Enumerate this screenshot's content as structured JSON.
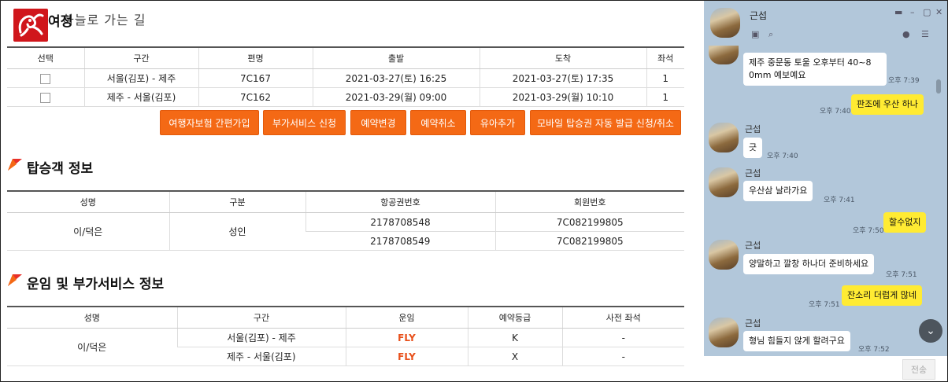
{
  "header": {
    "logo_text": "하늘로 가는 길",
    "itinerary_title": "여정"
  },
  "itinerary": {
    "headers": [
      "선택",
      "구간",
      "편명",
      "출발",
      "도착",
      "좌석"
    ],
    "rows": [
      {
        "route": "서울(김포) - 제주",
        "flight": "7C167",
        "depart": "2021-03-27(토) 16:25",
        "arrive": "2021-03-27(토) 17:35",
        "seats": "1"
      },
      {
        "route": "제주 - 서울(김포)",
        "flight": "7C162",
        "depart": "2021-03-29(월) 09:00",
        "arrive": "2021-03-29(월) 10:10",
        "seats": "1"
      }
    ]
  },
  "actions": {
    "insurance": "여행자보험 간편가입",
    "addon": "부가서비스 신청",
    "change": "예약변경",
    "cancel": "예약취소",
    "infant": "유아추가",
    "mobile_pass": "모바일 탑승권 자동 발급 신청/취소"
  },
  "passengers": {
    "title": "탑승객 정보",
    "headers": [
      "성명",
      "구분",
      "항공권번호",
      "회원번호"
    ],
    "name": "이/덕은",
    "type": "성인",
    "tickets": [
      "2178708548",
      "2178708549"
    ],
    "members": [
      "7C082199805",
      "7C082199805"
    ]
  },
  "fare": {
    "title": "운임 및 부가서비스 정보",
    "headers": [
      "성명",
      "구간",
      "운임",
      "예약등급",
      "사전 좌석"
    ],
    "name": "이/덕은",
    "rows": [
      {
        "route": "서울(김포) - 제주",
        "fare": "FLY",
        "class": "K",
        "seat": "-"
      },
      {
        "route": "제주 - 서울(김포)",
        "fare": "FLY",
        "class": "X",
        "seat": "-"
      }
    ]
  },
  "chat": {
    "contact": "근섭",
    "messages": [
      {
        "from": "them",
        "text1": "제주 중문동 토울 오후부터  40~8",
        "text2": "0mm  예보예요",
        "time": "오후 7:39"
      },
      {
        "from": "me",
        "text": "판조에 우산 하나",
        "time": "오후 7:40"
      },
      {
        "from": "them",
        "name": "근섭",
        "text": "긋",
        "time": "오후 7:40"
      },
      {
        "from": "them",
        "name": "근섭",
        "text": "우산삼  날라가요",
        "time": "오후 7:41"
      },
      {
        "from": "me",
        "text": "할수없지",
        "time": "오후 7:50"
      },
      {
        "from": "them",
        "name": "근섭",
        "text": "양말하고  깔창 하나더 준비하세요",
        "time": "오후 7:51"
      },
      {
        "from": "me",
        "text": "잔소리 더럽게 많네",
        "time": "오후 7:51"
      },
      {
        "from": "them",
        "name": "근섭",
        "text": "형님 힘들지 않게 할려구요",
        "time": "오후 7:52"
      }
    ],
    "send_label": "전송"
  },
  "colors": {
    "accent": "#f46915",
    "chat_bg": "#b2c7da",
    "my_bubble": "#ffeb33",
    "fare": "#e8501b"
  }
}
